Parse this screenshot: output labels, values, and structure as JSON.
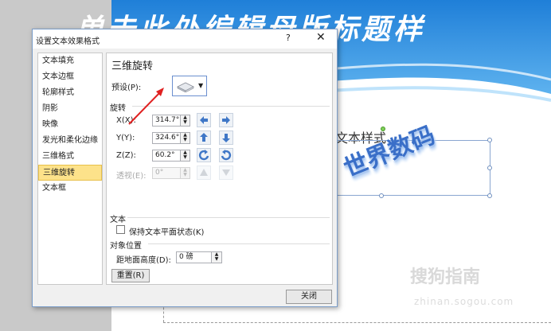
{
  "slide": {
    "title": "单击此处编辑母版标题样",
    "subtitle_fragment": "文本样式",
    "wordart": "世界数码",
    "watermark": "搜狗指南",
    "watermark_url": "zhinan.sogou.com"
  },
  "dialog": {
    "title": "设置文本效果格式",
    "help": "?",
    "close_x": "✕",
    "close_button": "关闭"
  },
  "nav": {
    "items": [
      {
        "label": "文本填充"
      },
      {
        "label": "文本边框"
      },
      {
        "label": "轮廓样式"
      },
      {
        "label": "阴影"
      },
      {
        "label": "映像"
      },
      {
        "label": "发光和柔化边缘"
      },
      {
        "label": "三维格式"
      },
      {
        "label": "三维旋转",
        "active": true
      },
      {
        "label": "文本框"
      }
    ]
  },
  "panel": {
    "title": "三维旋转",
    "preset_label": "预设(P):",
    "rotation_section": "旋转",
    "x_label": "X(X):",
    "x_value": "314.7°",
    "y_label": "Y(Y):",
    "y_value": "324.6°",
    "z_label": "Z(Z):",
    "z_value": "60.2°",
    "perspective_label": "透视(E):",
    "perspective_value": "0°",
    "text_section": "文本",
    "keep_flat_label": "保持文本平面状态(K)",
    "keep_flat_checked": false,
    "object_position_section": "对象位置",
    "distance_label": "距地面高度(D):",
    "distance_value": "0 磅",
    "reset_label": "重置(R)"
  },
  "colors": {
    "accent": "#6b8fcf",
    "nav_active_bg": "#fde28a",
    "annotation_arrow": "#e02020",
    "slide_banner": "#2f8fe0"
  },
  "icons": {
    "spin_up": "▲",
    "spin_down": "▼",
    "dropdown": "▼"
  }
}
